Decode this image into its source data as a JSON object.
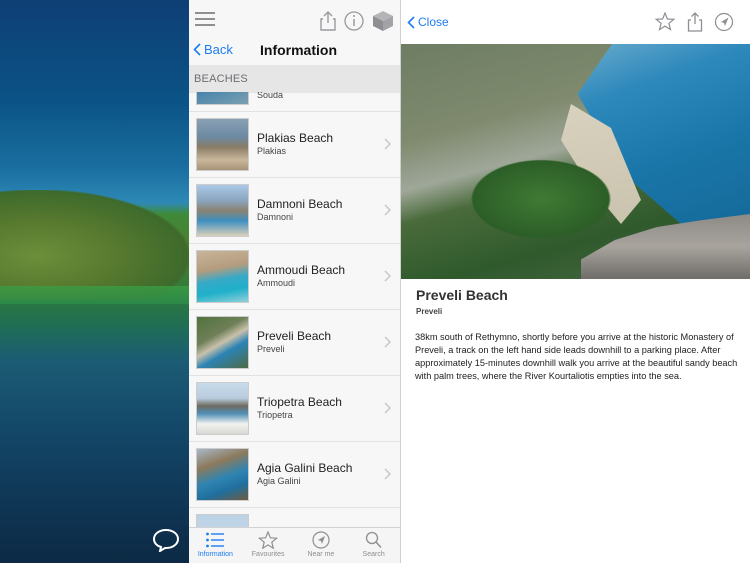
{
  "list_panel": {
    "nav": {
      "back_label": "Back",
      "title": "Information"
    },
    "section_header": "BEACHES",
    "partial_item": {
      "sub": "Souda"
    },
    "items": [
      {
        "name": "Plakias Beach",
        "sub": "Plakias"
      },
      {
        "name": "Damnoni Beach",
        "sub": "Damnoni"
      },
      {
        "name": "Ammoudi Beach",
        "sub": "Ammoudi"
      },
      {
        "name": "Preveli Beach",
        "sub": "Preveli"
      },
      {
        "name": "Triopetra Beach",
        "sub": "Triopetra"
      },
      {
        "name": "Agia Galini Beach",
        "sub": "Agia Galini"
      }
    ],
    "tabbar": [
      {
        "label": "Information",
        "icon": "list-icon",
        "active": true
      },
      {
        "label": "Favourites",
        "icon": "star-icon",
        "active": false
      },
      {
        "label": "Near me",
        "icon": "location-icon",
        "active": false
      },
      {
        "label": "Search",
        "icon": "search-icon",
        "active": false
      }
    ]
  },
  "detail_panel": {
    "close_label": "Close",
    "title": "Preveli Beach",
    "subtitle": "Preveli",
    "body": "38km south of Rethymno, shortly before you arrive at the historic Monastery of Preveli, a track on the left hand side leads downhill to a parking place. After approximately 15-minutes downhill walk you arrive at the beautiful sandy beach with palm trees, where the River Kourtaliotis empties into the sea."
  },
  "colors": {
    "accent": "#1d7cf2",
    "icon_gray": "#8e8e93"
  }
}
